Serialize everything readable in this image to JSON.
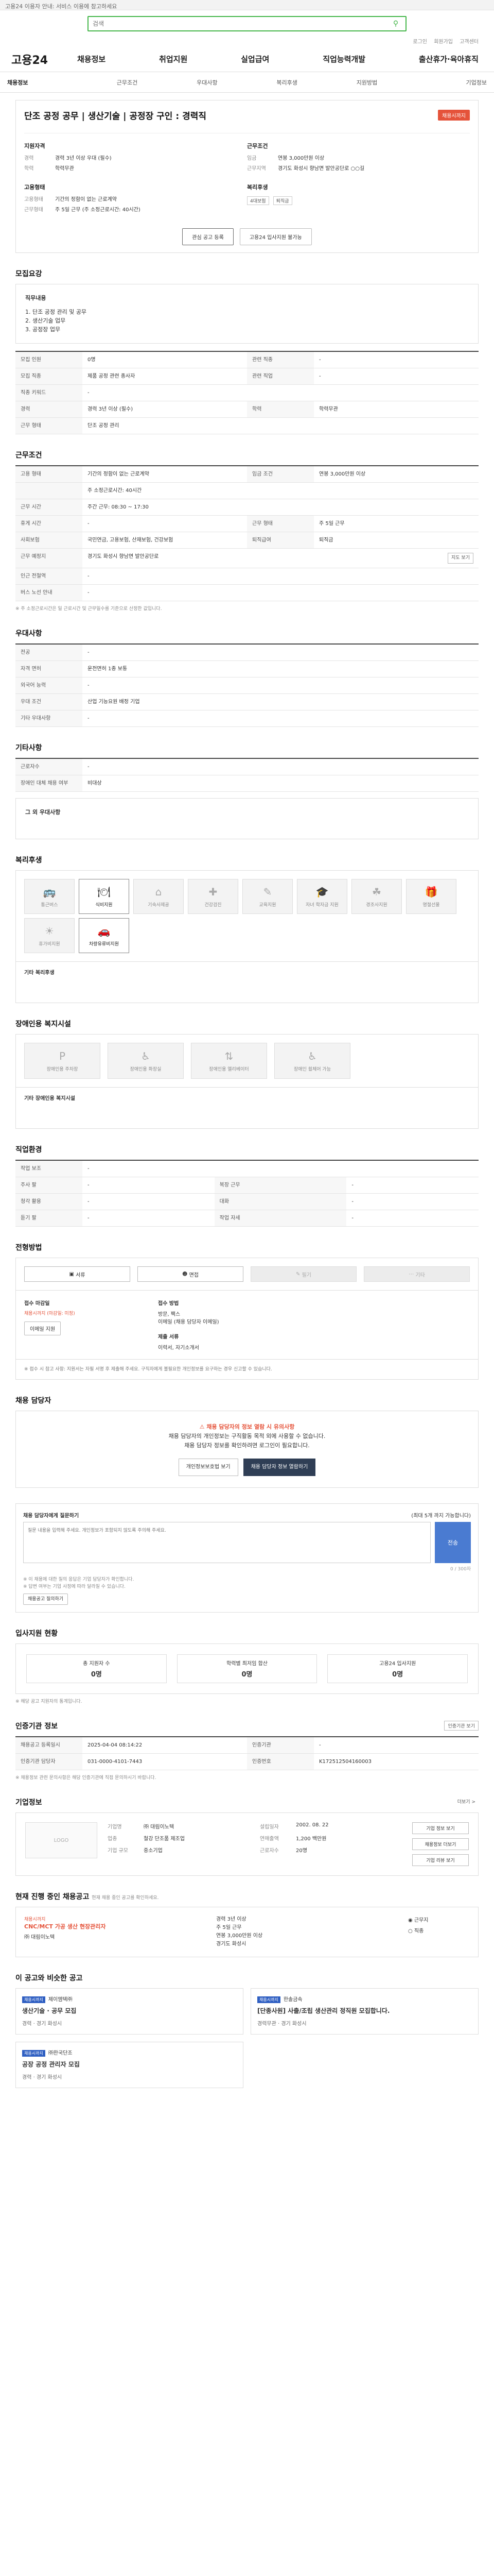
{
  "top_notice": "고용24 이용자 안내: 서비스 이용에 참고하세요",
  "search": {
    "value": "",
    "placeholder": "검색"
  },
  "util_links": [
    "로그인",
    "회원가입",
    "고객센터"
  ],
  "header": {
    "logo": "고용24",
    "gnb": [
      "채용정보",
      "취업지원",
      "실업급여",
      "직업능력개발",
      "출산휴가·육아휴직"
    ]
  },
  "subnav": [
    "채용정보",
    "근무조건",
    "우대사항",
    "복리후생",
    "지원방법",
    "기업정보"
  ],
  "job": {
    "title": "단조 공정 공무 | 생산기술 | 공정장 구인 : 경력직",
    "badge": "채용시까지",
    "company_header": "지원자격",
    "condition_header": "근무조건",
    "company_rows": [
      {
        "k": "경력",
        "v": "경력 3년 이상 우대 (필수)"
      },
      {
        "k": "학력",
        "v": "학력무관"
      }
    ],
    "condition_rows": [
      {
        "k": "임금",
        "v": "연봉 3,000만원 이상"
      },
      {
        "k": "근무지역",
        "v": "경기도 화성시 향남면 발안공단로 ○○길"
      }
    ],
    "type_header": "고용형태",
    "type_rows": [
      {
        "k": "고용형태",
        "v": "기간의 정함이 없는 근로계약"
      },
      {
        "k": "근무형태",
        "v": "주 5일 근무 (주 소정근로시간: 40시간)"
      }
    ],
    "benefit_header": "복리후생",
    "benefit_tags": [
      "4대보험",
      "퇴직금"
    ],
    "btn_apply": "관심 공고 등록",
    "btn_share": "고용24 입사지원 불가능"
  },
  "recruit": {
    "title": "모집요강",
    "duty_label": "직무내용",
    "duty_lines": [
      "1. 단조 공정 관리 및 공무",
      "2. 생산기술 업무",
      "3. 공정장 업무"
    ],
    "table": [
      {
        "k": "모집 인원",
        "v": "0명",
        "k2": "관련 직종",
        "v2": "-"
      },
      {
        "k": "모집 직종",
        "v": "제품 공정 관련 종사자",
        "k2": "관련 직업",
        "v2": "-"
      },
      {
        "k": "직종 키워드",
        "v": "-",
        "k2": "",
        "v2": ""
      },
      {
        "k": "경력",
        "v": "경력 3년 이상 (필수)",
        "k2": "학력",
        "v2": "학력무관"
      },
      {
        "k": "근무 형태",
        "v": "단조 공정 관리",
        "k2": "",
        "v2": ""
      }
    ]
  },
  "conditions": {
    "title": "근무조건",
    "table": [
      {
        "k": "고용 형태",
        "v": "기간의 정함이 없는 근로계약",
        "k2": "임금 조건",
        "v2": "연봉 3,000만원 이상"
      },
      {
        "k": "",
        "v": "주 소정근로시간: 40시간",
        "k2": "",
        "v2": ""
      },
      {
        "k": "근무 시간",
        "v": "주간 근무: 08:30 ~ 17:30",
        "k2": "",
        "v2": ""
      },
      {
        "k": "휴게 시간",
        "v": "-",
        "k2": "근무 형태",
        "v2": "주 5일 근무"
      },
      {
        "k": "사회보험",
        "v": "국민연금, 고용보험, 산재보험, 건강보험",
        "k2": "퇴직급여",
        "v2": "퇴직금"
      },
      {
        "k": "근무 예정지",
        "v": "경기도 화성시 향남면 발안공단로",
        "k2": "",
        "v2": ""
      },
      {
        "k": "인근 전철역",
        "v": "-",
        "k2": "",
        "v2": ""
      },
      {
        "k": "버스 노선 안내",
        "v": "-",
        "k2": "",
        "v2": ""
      }
    ],
    "map_btn": "지도 보기",
    "note": "※ 주 소정근로시간은 일 근로시간 및 근무일수를 기준으로 산정한 값입니다."
  },
  "preference": {
    "title": "우대사항",
    "table": [
      {
        "k": "전공",
        "v": "-"
      },
      {
        "k": "자격 면허",
        "v": "운전면허 1종 보통"
      },
      {
        "k": "외국어 능력",
        "v": "-"
      },
      {
        "k": "우대 조건",
        "v": "산업 기능요원 배정 기업"
      },
      {
        "k": "기타 우대사항",
        "v": "-"
      }
    ]
  },
  "etc": {
    "title": "기타사항",
    "table": [
      {
        "k": "근로자수",
        "v": "-"
      },
      {
        "k": "장애인 대체 채용 여부",
        "v": "비대상"
      }
    ],
    "extra_label": "그 외 우대사항"
  },
  "welfare": {
    "title": "복리후생",
    "tiles": [
      {
        "label": "통근버스",
        "on": false,
        "icon": "bus-icon"
      },
      {
        "label": "식비지원",
        "on": true,
        "icon": "meal-icon"
      },
      {
        "label": "기숙사제공",
        "on": false,
        "icon": "house-icon"
      },
      {
        "label": "건강검진",
        "on": false,
        "icon": "health-icon"
      },
      {
        "label": "교육지원",
        "on": false,
        "icon": "study-icon"
      },
      {
        "label": "자녀 학자금 지원",
        "on": false,
        "icon": "grad-icon"
      },
      {
        "label": "경조사지원",
        "on": false,
        "icon": "gift-icon"
      },
      {
        "label": "명절선물",
        "on": false,
        "icon": "present-icon"
      },
      {
        "label": "휴가비지원",
        "on": false,
        "icon": "vacation-icon"
      },
      {
        "label": "차량유류비지원",
        "on": true,
        "icon": "car-icon"
      }
    ],
    "extra_label": "기타 복리후생"
  },
  "disability": {
    "title": "장애인용 복지시설",
    "tiles": [
      {
        "label": "장애인용 주차장",
        "icon": "parking-icon"
      },
      {
        "label": "장애인용 화장실",
        "icon": "toilet-icon"
      },
      {
        "label": "장애인용 엘리베이터",
        "icon": "elevator-icon"
      },
      {
        "label": "장애인 휠체어 가능",
        "icon": "wheelchair-icon"
      }
    ],
    "extra_label": "기타 장애인용 복지시설"
  },
  "selection": {
    "title": "직업환경",
    "table": [
      {
        "k": "작업 보조",
        "v": "-",
        "k2": "",
        "v2": ""
      },
      {
        "k": "주사 팔",
        "v": "-",
        "k2": "복장 근무",
        "v2": "-"
      },
      {
        "k": "청각 활용",
        "v": "-",
        "k2": "대화",
        "v2": "-"
      },
      {
        "k": "듣기 팔",
        "v": "-",
        "k2": "작업 자세",
        "v2": "-"
      }
    ]
  },
  "apply": {
    "title": "전형방법",
    "tabs": [
      {
        "label": "서류",
        "dim": false
      },
      {
        "label": "면접",
        "dim": false
      },
      {
        "label": "필기",
        "dim": true
      },
      {
        "label": "기타",
        "dim": true
      }
    ],
    "deadline_label": "접수 마감일",
    "deadline_value": "채용시까지 (마감일: 미정)",
    "deadline_btn": "이메일 지원",
    "method_label": "접수 방법",
    "method_lines": [
      "방문, 팩스",
      "이메일 (채용 담당자 이메일)"
    ],
    "doc_label": "제출 서류",
    "doc_lines": [
      "이력서, 자기소개서"
    ],
    "notice": "※ 접수 시 참고 사항: 지원서는 자필 서명 후 제출해 주세요. 구직자에게 불필요한 개인정보를 요구하는 경우 신고할 수 있습니다."
  },
  "contact": {
    "title": "채용 담당자",
    "line1": "채용 담당자의 정보 열람 시 유의사항",
    "line2": "채용 담당자의 개인정보는 구직활동 목적 외에 사용할 수 없습니다.",
    "line3": "채용 담당자 정보를 확인하려면 로그인이 필요합니다.",
    "btn1": "개인정보보호법 보기",
    "btn2": "채용 담당자 정보 열람하기"
  },
  "qa": {
    "title": "채용 담당자에게 질문하기",
    "hint": "(최대 5개 까지 가능합니다)",
    "placeholder": "질문 내용을 입력해 주세요. 개인정보가 포함되지 않도록 주의해 주세요.",
    "counter": "0 / 300자",
    "send": "전송",
    "notes": [
      "※ 이 채용에 대한 질의 응답은 기업 담당자가 확인합니다.",
      "※ 답변 여부는 기업 사정에 따라 달라질 수 있습니다."
    ],
    "more_btn": "채용공고 질의하기"
  },
  "stats": {
    "title": "입사지원 현황",
    "items": [
      {
        "label": "총 지원자 수",
        "value": "0명"
      },
      {
        "label": "학력별 최저임 합산",
        "value": "0명"
      },
      {
        "label": "고용24 입사지원",
        "value": "0명"
      }
    ],
    "note": "※ 해당 공고 지원자의 통계입니다."
  },
  "info": {
    "title": "인증기관 정보",
    "btn": "인증기관 보기",
    "table": [
      {
        "k": "채용공고 등록일시",
        "v": "2025-04-04 08:14:22",
        "k2": "인증기관",
        "v2": "-"
      },
      {
        "k": "인증기관 담당자",
        "v": "031-0000-4101-7443",
        "k2": "인증번호",
        "v2": "K172512504160003"
      }
    ],
    "note": "※ 채용정보 관련 문의사항은 해당 인증기관에 직접 문의하시기 바랍니다."
  },
  "company": {
    "title": "기업정보",
    "more": "더보기 >",
    "logo_placeholder": "LOGO",
    "rows": [
      {
        "k": "기업명",
        "v": "㈜ 대림이노텍"
      },
      {
        "k": "업종",
        "v": "철강 단조품 제조업"
      },
      {
        "k": "기업 규모",
        "v": "중소기업"
      },
      {
        "k": "설립일자",
        "v": "2002. 08. 22"
      },
      {
        "k": "연매출액",
        "v": "1,200 백만원"
      },
      {
        "k": "근로자수",
        "v": "20명"
      }
    ],
    "btns": [
      "기업 정보 보기",
      "채용정보 더보기",
      "기업 리뷰 보기"
    ]
  },
  "other": {
    "title": "현재 진행 중인 채용공고",
    "subtitle": "현재 채용 중인 공고를 확인하세요.",
    "job_label": "채용시까지",
    "job_name": "CNC/MCT 가공 생산 현장관리자",
    "job_company": "㈜ 대림이노텍",
    "meta": [
      "경력 3년 이상",
      "주 5일 근무",
      "연봉 3,000만원 이상",
      "경기도 화성시"
    ],
    "radio": [
      "근무지",
      "직종"
    ]
  },
  "similar": {
    "title": "이 공고와 비슷한 공고",
    "cards": [
      {
        "tag": "채용시까지",
        "company": "제이엠텍㈜",
        "name": "생산기술 · 공무 모집",
        "meta": "경력 · 경기 화성시"
      },
      {
        "tag": "채용시까지",
        "company": "한솔금속",
        "name": "[단종사원] 사출/조립 생산관리 정직원 모집합니다.",
        "meta": "경력무관 · 경기 화성시"
      },
      {
        "tag": "채용시까지",
        "company": "㈜한국단조",
        "name": "공장 공정 관리자 모집",
        "meta": "경력 · 경기 화성시"
      }
    ]
  }
}
